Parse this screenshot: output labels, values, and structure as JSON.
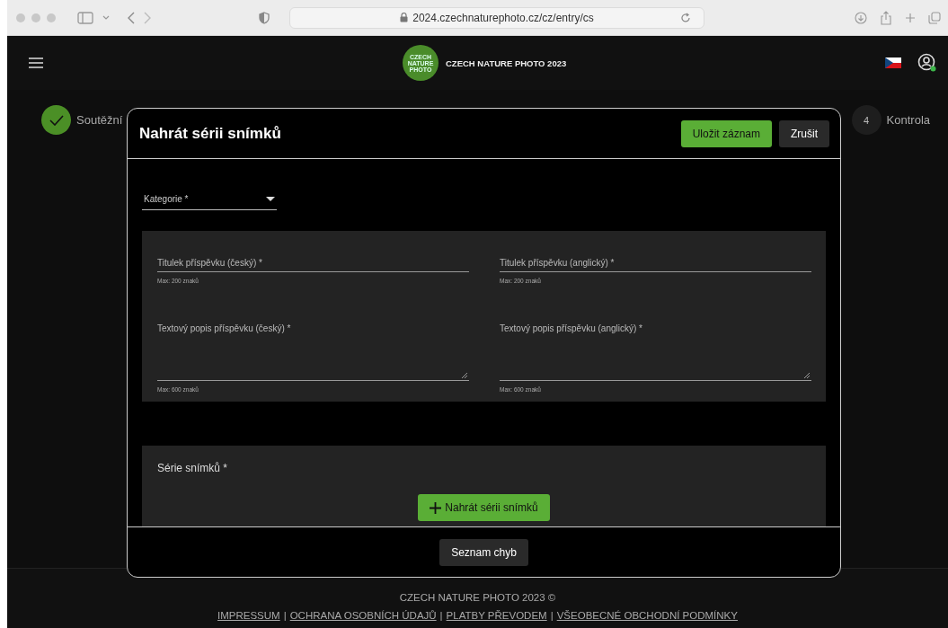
{
  "browser": {
    "url": "2024.czechnaturephoto.cz/cz/entry/cs"
  },
  "nav": {
    "logo_text": "CZECH NATURE PHOTO",
    "title": "CZECH NATURE PHOTO 2023",
    "user_online": true
  },
  "steps": [
    {
      "kind": "done",
      "label": "Soutěžní"
    },
    {
      "kind": "number",
      "number": "4",
      "label": "Kontrola"
    }
  ],
  "modal": {
    "title": "Nahrát sérii snímků",
    "save_button": "Uložit záznam",
    "cancel_button": "Zrušit",
    "category": {
      "placeholder": "Kategorie *"
    },
    "fields": [
      {
        "kind": "input",
        "label": "Titulek příspěvku (český) *",
        "hint": "Max: 200 znaků"
      },
      {
        "kind": "input",
        "label": "Titulek příspěvku (anglický) *",
        "hint": "Max: 200 znaků"
      },
      {
        "kind": "textarea",
        "label": "Textový popis příspěvku (český) *",
        "hint": "Max: 600 znaků"
      },
      {
        "kind": "textarea",
        "label": "Textový popis příspěvku (anglický) *",
        "hint": "Max: 600 znaků"
      }
    ],
    "series": {
      "label": "Série snímků *",
      "upload_button": "Nahrát sérii snímků"
    },
    "errors_button": "Seznam chyb"
  },
  "footer": {
    "copyright": "CZECH NATURE PHOTO 2023 ©",
    "links": [
      {
        "label": "IMPRESSUM",
        "separator": "|"
      },
      {
        "label": "OCHRANA OSOBNÍCH ÚDAJŮ",
        "separator": "|"
      },
      {
        "label": "PLATBY PŘEVODEM",
        "separator": "|"
      },
      {
        "label": "VŠEOBECNÉ OBCHODNÍ PODMÍNKY"
      }
    ]
  }
}
